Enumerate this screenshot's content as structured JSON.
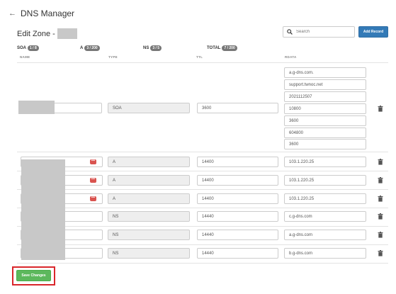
{
  "header": {
    "back_icon": "arrow-left-icon",
    "title": "DNS Manager"
  },
  "zone": {
    "title": "Edit Zone -"
  },
  "search": {
    "placeholder": "Search",
    "icon": "search-icon"
  },
  "add_record_label": "Add Record",
  "counts": [
    {
      "label": "SOA",
      "badge": "1 / 8"
    },
    {
      "label": "A",
      "badge": "3 / 200"
    },
    {
      "label": "NS",
      "badge": "3 / 5"
    },
    {
      "label": "TOTAL",
      "badge": "7 / 200"
    }
  ],
  "columns": {
    "name": "NAME",
    "type": "TYPE",
    "ttl": "TTL",
    "rdata": "RDATA"
  },
  "soa": {
    "type": "SOA",
    "ttl": "3600",
    "rdata": [
      "a.g-dns.com.",
      "support.twnoc.net",
      "2021112507",
      "10800",
      "3600",
      "604800",
      "3600"
    ]
  },
  "records": [
    {
      "type": "A",
      "ttl": "14400",
      "rdata": "103.1.220.25",
      "menu": "•••"
    },
    {
      "type": "A",
      "ttl": "14400",
      "rdata": "103.1.220.25",
      "menu": "•••"
    },
    {
      "type": "A",
      "ttl": "14400",
      "rdata": "103.1.220.25",
      "menu": "•••"
    },
    {
      "type": "NS",
      "ttl": "14440",
      "rdata": "c.g-dns.com"
    },
    {
      "type": "NS",
      "ttl": "14440",
      "rdata": "a.g-dns.com"
    },
    {
      "type": "NS",
      "ttl": "14440",
      "rdata": "b.g-dns.com"
    }
  ],
  "save_label": "Save Changes",
  "colors": {
    "primary": "#337ab7",
    "success": "#5cb85c",
    "danger": "#d9534f",
    "highlight": "#d9262b"
  }
}
